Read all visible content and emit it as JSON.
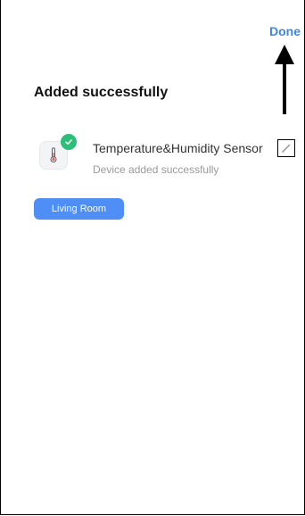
{
  "header": {
    "done_label": "Done"
  },
  "main": {
    "title": "Added successfully",
    "device": {
      "name": "Temperature&Humidity Sensor",
      "status": "Device added successfully",
      "icon": "thermometer-icon",
      "badge_icon": "check-icon"
    },
    "room_label": "Living Room"
  },
  "colors": {
    "accent": "#3d87e6",
    "room_button": "#4f8ef5",
    "success": "#2dbe77"
  }
}
